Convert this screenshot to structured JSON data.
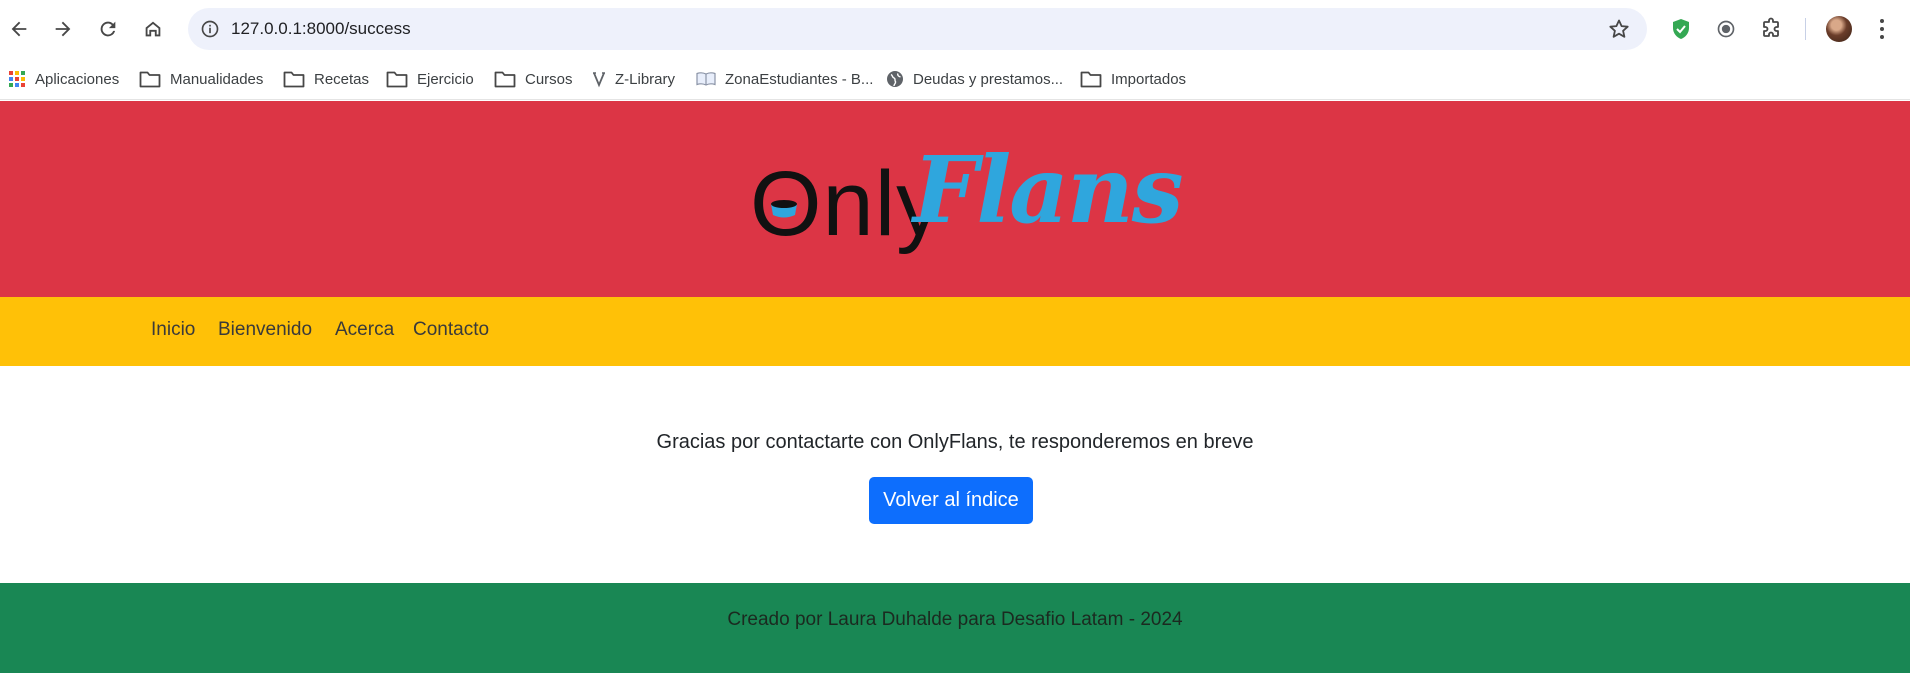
{
  "browser": {
    "url": "127.0.0.1:8000/success",
    "bookmarks": [
      {
        "label": "Aplicaciones",
        "icon": "apps-grid-icon"
      },
      {
        "label": "Manualidades",
        "icon": "folder-icon"
      },
      {
        "label": "Recetas",
        "icon": "folder-icon"
      },
      {
        "label": "Ejercicio",
        "icon": "folder-icon"
      },
      {
        "label": "Cursos",
        "icon": "folder-icon"
      },
      {
        "label": "Z-Library",
        "icon": "zlibrary-icon"
      },
      {
        "label": "ZonaEstudiantes - B...",
        "icon": "book-icon"
      },
      {
        "label": "Deudas y prestamos...",
        "icon": "globe-icon"
      },
      {
        "label": "Importados",
        "icon": "folder-icon"
      }
    ]
  },
  "site": {
    "logo": {
      "part1": "Only",
      "part2": "Flans"
    },
    "nav": [
      "Inicio",
      "Bienvenido",
      "Acerca",
      "Contacto"
    ],
    "message": "Gracias por contactarte con OnlyFlans, te responderemos en breve",
    "button_label": "Volver al índice",
    "footer": "Creado por Laura Duhalde para Desafio Latam - 2024"
  },
  "colors": {
    "header": "#dc3545",
    "nav": "#ffc107",
    "footer": "#198754",
    "button": "#0d6efd",
    "logo_accent": "#2fa6dd"
  }
}
